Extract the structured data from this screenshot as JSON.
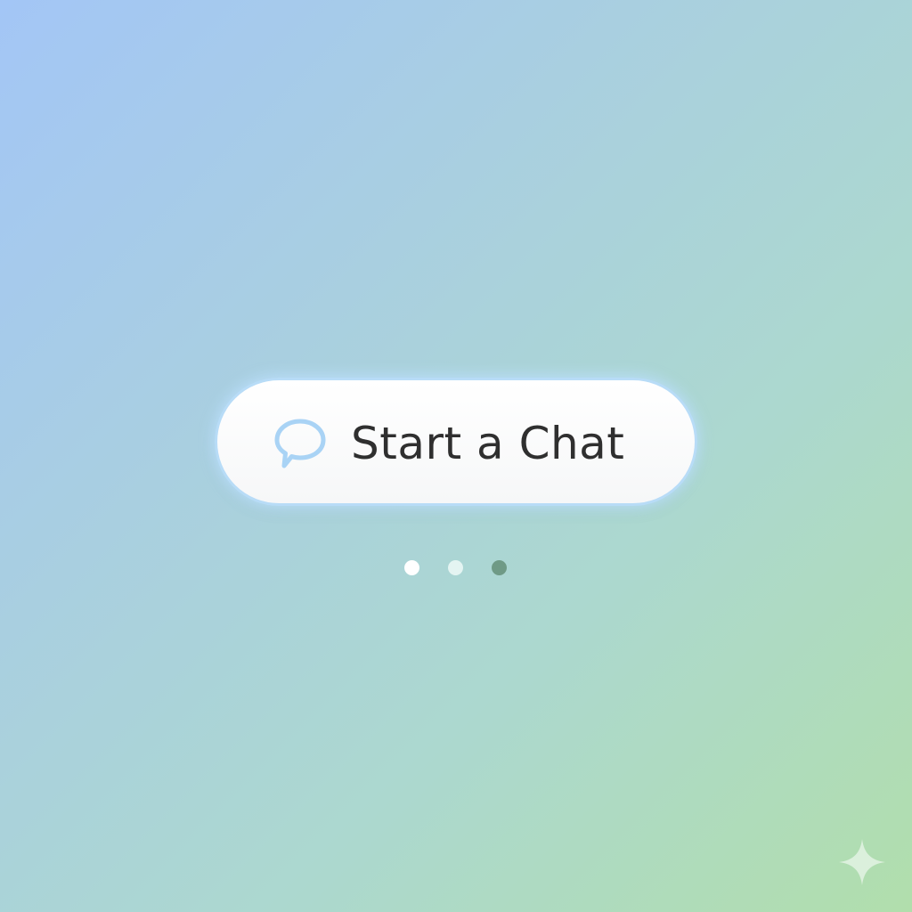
{
  "primary_button": {
    "label": "Start a Chat",
    "icon": "chat-bubble-icon",
    "icon_color": "#a9d3f5",
    "text_color": "#2f2f2f"
  },
  "pagination": {
    "page_count": 3,
    "active_index": 2,
    "dot_colors": [
      "#ffffff",
      "#e4f4f2",
      "#6f9a86"
    ]
  },
  "corner_mark": {
    "icon": "sparkle-icon"
  },
  "background": {
    "gradient_start": "#a3c6f6",
    "gradient_end": "#b1deac"
  }
}
